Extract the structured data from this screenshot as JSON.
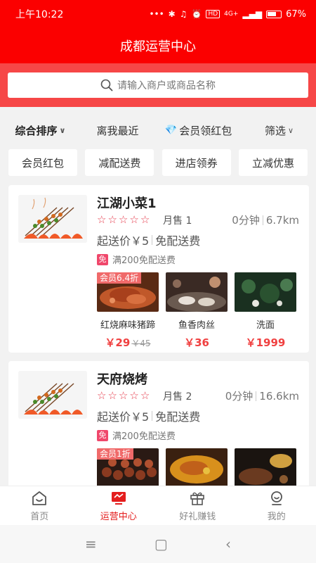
{
  "status_bar": {
    "time": "上午10:22",
    "signal_badge": "HD",
    "network": "4G+",
    "battery": "67%"
  },
  "header": {
    "title": "成都运营中心"
  },
  "search": {
    "placeholder": "请输入商户或商品名称"
  },
  "sort_tabs": [
    {
      "label": "综合排序"
    },
    {
      "label": "离我最近"
    },
    {
      "label": "会员领红包"
    },
    {
      "label": "筛选"
    }
  ],
  "filters": [
    {
      "label": "会员红包"
    },
    {
      "label": "减配送费"
    },
    {
      "label": "进店领券"
    },
    {
      "label": "立减优惠"
    }
  ],
  "shops": [
    {
      "name": "江湖小菜1",
      "rating_stars": 5,
      "sales": "月售 1",
      "time": "0分钟",
      "distance": "6.7km",
      "min_order": "起送价￥5",
      "delivery_fee": "免配送费",
      "promo_tag": "免",
      "promo_text": "满200免配送费",
      "products": [
        {
          "discount": "会员6.4折",
          "name": "红烧麻味猪蹄",
          "price": "￥29",
          "old_price": "￥45"
        },
        {
          "discount": "",
          "name": "鱼香肉丝",
          "price": "￥36",
          "old_price": ""
        },
        {
          "discount": "",
          "name": "洗面",
          "price": "￥1999",
          "old_price": ""
        }
      ]
    },
    {
      "name": "天府烧烤",
      "rating_stars": 5,
      "sales": "月售 2",
      "time": "0分钟",
      "distance": "16.6km",
      "min_order": "起送价￥5",
      "delivery_fee": "免配送费",
      "promo_tag": "免",
      "promo_text": "满200免配送费",
      "products": [
        {
          "discount": "会员1折"
        },
        {
          "discount": ""
        },
        {
          "discount": ""
        }
      ]
    }
  ],
  "bottom_nav": [
    {
      "label": "首页",
      "icon": "home-icon"
    },
    {
      "label": "运营中心",
      "icon": "monitor-icon"
    },
    {
      "label": "好礼赚钱",
      "icon": "gift-icon"
    },
    {
      "label": "我的",
      "icon": "profile-icon"
    }
  ],
  "colors": {
    "primary": "#fb0000",
    "price": "#f04040",
    "active_nav": "#e41d1d"
  }
}
